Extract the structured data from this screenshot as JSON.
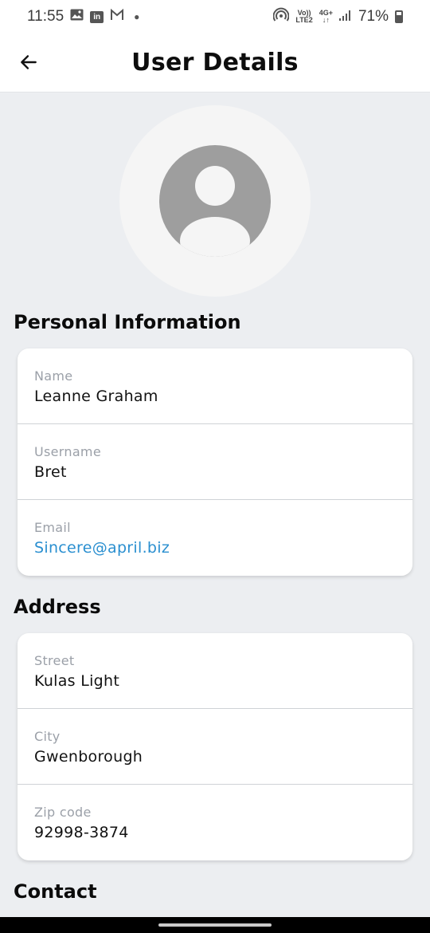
{
  "status_bar": {
    "time": "11:55",
    "notification_icons": [
      "gallery-icon",
      "linkedin-icon",
      "gmail-icon"
    ],
    "volte_label_top": "Vo))",
    "volte_label_bottom": "LTE2",
    "network_label_top": "4G+",
    "network_label_bottom": "↓↑",
    "battery": "71%"
  },
  "header": {
    "title": "User Details",
    "back_icon": "arrow-left-icon"
  },
  "avatar": {
    "icon": "person-placeholder-icon",
    "color": "#9e9e9e",
    "background": "#f5f5f5"
  },
  "sections": {
    "personal": {
      "title": "Personal Information",
      "fields": [
        {
          "label": "Name",
          "value": "Leanne Graham"
        },
        {
          "label": "Username",
          "value": "Bret"
        },
        {
          "label": "Email",
          "value": "Sincere@april.biz"
        }
      ]
    },
    "address": {
      "title": "Address",
      "fields": [
        {
          "label": "Street",
          "value": "Kulas Light"
        },
        {
          "label": "City",
          "value": "Gwenborough"
        },
        {
          "label": "Zip code",
          "value": "92998-3874"
        }
      ]
    },
    "contact": {
      "title": "Contact"
    }
  },
  "colors": {
    "background": "#eceef1",
    "card": "#ffffff",
    "label": "#9ba0a8",
    "link": "#2a8fd0"
  }
}
